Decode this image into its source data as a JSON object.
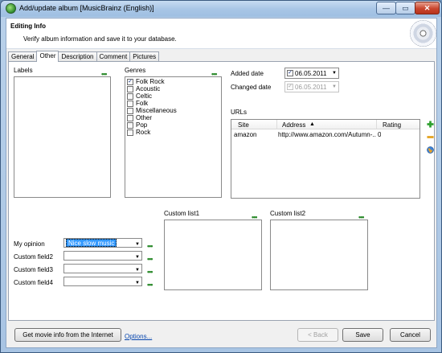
{
  "window": {
    "title": "Add/update album [MusicBrainz (English)]",
    "minimize": "—",
    "maximize": "▭",
    "close": "✕"
  },
  "header": {
    "title": "Editing Info",
    "subtitle": "Verify album information and save it to your database."
  },
  "tabs": [
    "General",
    "Other",
    "Description",
    "Comment",
    "Pictures"
  ],
  "labels_section": {
    "label": "Labels",
    "more": "•••"
  },
  "genres_section": {
    "label": "Genres",
    "more": "•••",
    "items": [
      {
        "name": "Folk Rock",
        "checked": true
      },
      {
        "name": "Acoustic",
        "checked": false
      },
      {
        "name": "Celtic",
        "checked": false
      },
      {
        "name": "Folk",
        "checked": false
      },
      {
        "name": "Miscellaneous",
        "checked": false
      },
      {
        "name": "Other",
        "checked": false
      },
      {
        "name": "Pop",
        "checked": false
      },
      {
        "name": "Rock",
        "checked": false
      }
    ]
  },
  "dates": {
    "added_label": "Added date",
    "added_value": "06.05.2011",
    "added_checked": true,
    "changed_label": "Changed date",
    "changed_value": "06.05.2011",
    "changed_checked": true
  },
  "urls": {
    "label": "URLs",
    "columns": [
      "Site",
      "Address",
      "Rating"
    ],
    "sort_indicator": "▲",
    "rows": [
      {
        "site": "amazon",
        "address": "http://www.amazon.com/Autumn-...",
        "rating": "0"
      }
    ]
  },
  "custom_fields": [
    {
      "label": "My opinion",
      "value": "Nice slow music"
    },
    {
      "label": "Custom field2",
      "value": ""
    },
    {
      "label": "Custom field3",
      "value": ""
    },
    {
      "label": "Custom field4",
      "value": ""
    }
  ],
  "custom_lists": [
    {
      "label": "Custom list1",
      "more": "•••"
    },
    {
      "label": "Custom list2",
      "more": "•••"
    }
  ],
  "footer": {
    "get_info_button": "Get movie info from the Internet",
    "options_link": "Options...",
    "back_button": "< Back",
    "save_button": "Save",
    "cancel_button": "Cancel"
  },
  "icons": {
    "add": "plus-icon",
    "remove": "minus-icon",
    "web": "globe-icon",
    "dropdown": "▼",
    "more": "•••",
    "check": "✓"
  }
}
